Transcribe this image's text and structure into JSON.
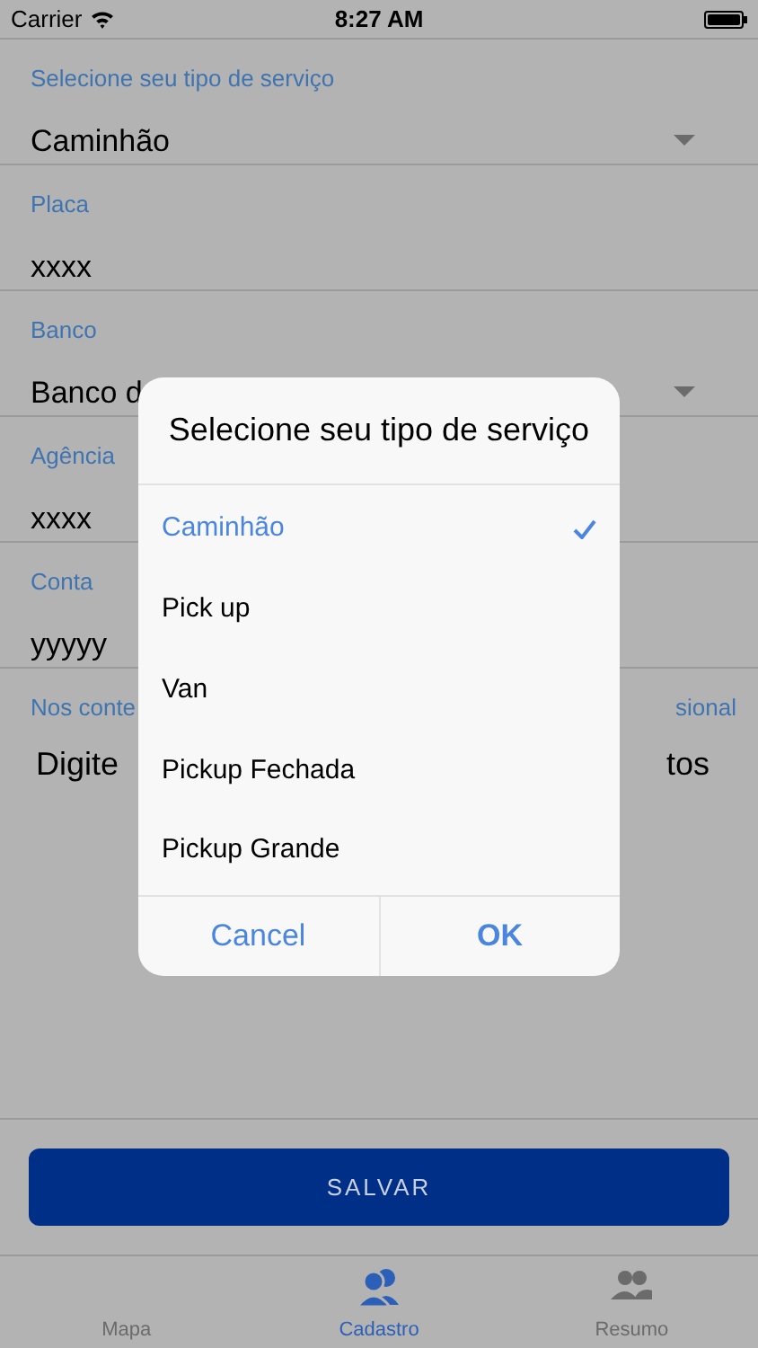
{
  "status_bar": {
    "carrier": "Carrier",
    "time": "8:27 AM"
  },
  "fields": [
    {
      "label": "Selecione seu tipo de serviço",
      "value": "Caminhão",
      "kind": "dropdown"
    },
    {
      "label": "Placa",
      "value": "xxxx",
      "kind": "text"
    },
    {
      "label": "Banco",
      "value": "Banco d",
      "kind": "dropdown"
    },
    {
      "label": "Agência",
      "value": "xxxx",
      "kind": "text"
    },
    {
      "label": "Conta",
      "value": "yyyyy",
      "kind": "text"
    },
    {
      "label": "Nos conte",
      "label_right": "sional",
      "value": "Digite",
      "value_right": "tos",
      "kind": "textarea"
    }
  ],
  "save_button": "SALVAR",
  "tabs": [
    {
      "label": "Mapa",
      "selected": false
    },
    {
      "label": "Cadastro",
      "selected": true
    },
    {
      "label": "Resumo",
      "selected": false
    }
  ],
  "dialog": {
    "title": "Selecione seu tipo de serviço",
    "options": [
      {
        "label": "Caminhão",
        "selected": true
      },
      {
        "label": "Pick up",
        "selected": false
      },
      {
        "label": "Van",
        "selected": false
      },
      {
        "label": "Pickup Fechada",
        "selected": false
      },
      {
        "label": "Pickup Grande",
        "selected": false
      }
    ],
    "buttons": [
      {
        "label": "Cancel",
        "kind": "cancel"
      },
      {
        "label": "OK",
        "kind": "confirm"
      }
    ]
  }
}
